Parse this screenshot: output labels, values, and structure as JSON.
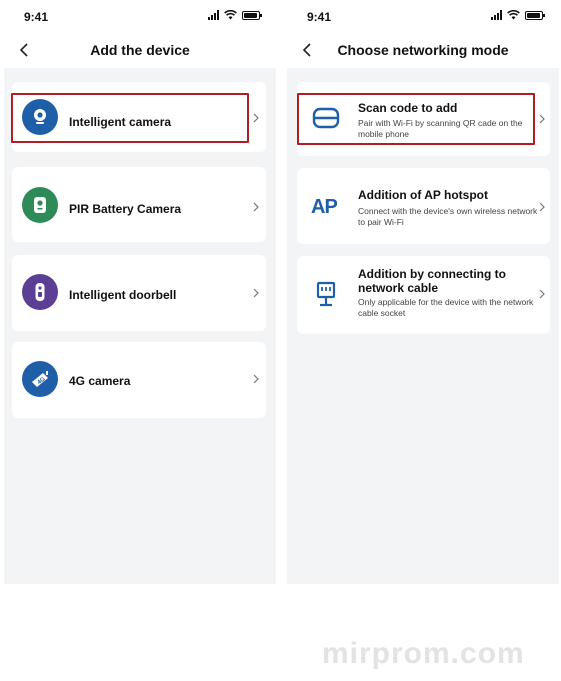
{
  "status_time": "9:41",
  "left_screen": {
    "title": "Add the device",
    "devices": [
      {
        "label": "Intelligent camera",
        "icon": "camera-icon",
        "color": "#1f5fa8"
      },
      {
        "label": "PIR Battery Camera",
        "icon": "pir-camera-icon",
        "color": "#2e8b57"
      },
      {
        "label": "Intelligent doorbell",
        "icon": "doorbell-icon",
        "color": "#5b3f95"
      },
      {
        "label": "4G camera",
        "icon": "4g-camera-icon",
        "color": "#1f5fa8"
      }
    ]
  },
  "right_screen": {
    "title": "Choose networking mode",
    "modes": [
      {
        "title": "Scan code to add",
        "desc": "Pair with Wi-Fi by scanning QR cade on the mobile phone",
        "icon": "scan-code-icon"
      },
      {
        "title": "Addition of AP hotspot",
        "desc": "Connect with the device's own wireless network to pair Wi-Fi",
        "icon": "ap-hotspot-icon",
        "icon_text": "AP"
      },
      {
        "title": "Addition by connecting to network cable",
        "desc": "Only applicable for the device with the network cable socket",
        "icon": "network-cable-icon"
      }
    ]
  },
  "colors": {
    "accent": "#1f5fa8",
    "highlight": "#b01e23"
  },
  "watermark": "mirprom.com"
}
